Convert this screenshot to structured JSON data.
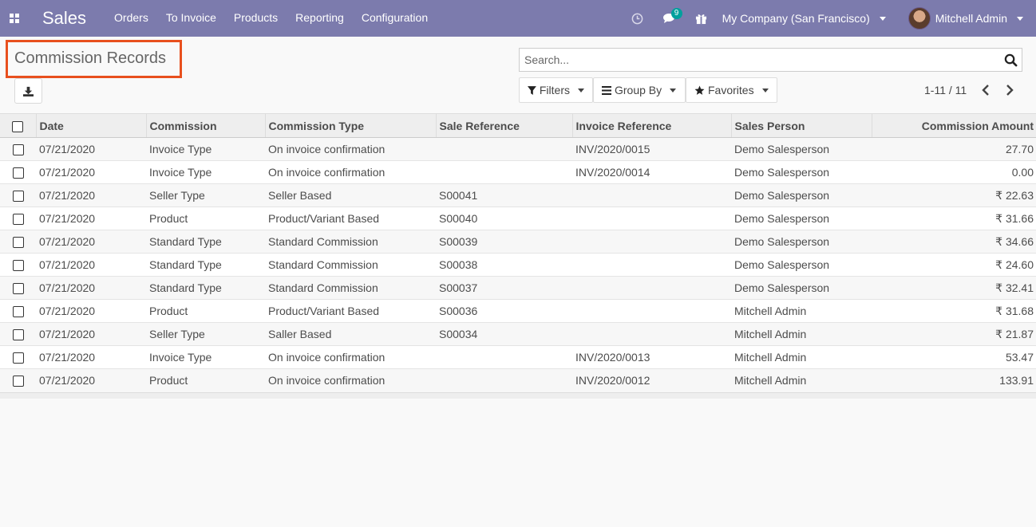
{
  "navbar": {
    "brand": "Sales",
    "menu": [
      "Orders",
      "To Invoice",
      "Products",
      "Reporting",
      "Configuration"
    ],
    "messages_count": "9",
    "company": "My Company (San Francisco)",
    "user": "Mitchell Admin"
  },
  "page": {
    "title": "Commission Records"
  },
  "search": {
    "placeholder": "Search..."
  },
  "buttons": {
    "filters": "Filters",
    "group_by": "Group By",
    "favorites": "Favorites"
  },
  "pager": {
    "value": "1-11 / 11"
  },
  "table": {
    "headers": [
      "Date",
      "Commission",
      "Commission Type",
      "Sale Reference",
      "Invoice Reference",
      "Sales Person",
      "Commission Amount"
    ],
    "rows": [
      [
        "07/21/2020",
        "Invoice Type",
        "On invoice confirmation",
        "",
        "INV/2020/0015",
        "Demo Salesperson",
        "27.70"
      ],
      [
        "07/21/2020",
        "Invoice Type",
        "On invoice confirmation",
        "",
        "INV/2020/0014",
        "Demo Salesperson",
        "0.00"
      ],
      [
        "07/21/2020",
        "Seller Type",
        "Seller Based",
        "S00041",
        "",
        "Demo Salesperson",
        "₹ 22.63"
      ],
      [
        "07/21/2020",
        "Product",
        "Product/Variant Based",
        "S00040",
        "",
        "Demo Salesperson",
        "₹ 31.66"
      ],
      [
        "07/21/2020",
        "Standard Type",
        "Standard Commission",
        "S00039",
        "",
        "Demo Salesperson",
        "₹ 34.66"
      ],
      [
        "07/21/2020",
        "Standard Type",
        "Standard Commission",
        "S00038",
        "",
        "Demo Salesperson",
        "₹ 24.60"
      ],
      [
        "07/21/2020",
        "Standard Type",
        "Standard Commission",
        "S00037",
        "",
        "Demo Salesperson",
        "₹ 32.41"
      ],
      [
        "07/21/2020",
        "Product",
        "Product/Variant Based",
        "S00036",
        "",
        "Mitchell Admin",
        "₹ 31.68"
      ],
      [
        "07/21/2020",
        "Seller Type",
        "Saller Based",
        "S00034",
        "",
        "Mitchell Admin",
        "₹ 21.87"
      ],
      [
        "07/21/2020",
        "Invoice Type",
        "On invoice confirmation",
        "",
        "INV/2020/0013",
        "Mitchell Admin",
        "53.47"
      ],
      [
        "07/21/2020",
        "Product",
        "On invoice confirmation",
        "",
        "INV/2020/0012",
        "Mitchell Admin",
        "133.91"
      ]
    ]
  },
  "icons": {
    "apps": "apps-grid-icon",
    "activity": "clock-icon",
    "messages": "chat-icon",
    "gift": "gift-icon",
    "export": "download-icon",
    "search": "search-icon",
    "filter": "filter-icon",
    "group_by": "list-icon",
    "favorites": "star-icon",
    "prev": "chevron-left-icon",
    "next": "chevron-right-icon"
  },
  "colors": {
    "navbar": "#7c7bad",
    "highlight_border": "#e8501e",
    "badge": "#00a09d"
  }
}
